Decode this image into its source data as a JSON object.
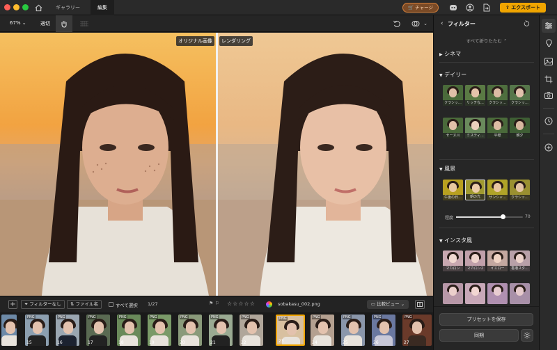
{
  "titlebar": {
    "tabs": [
      "ギャラリー",
      "編集"
    ],
    "charge_label": "チャージ",
    "export_label": "エクスポート"
  },
  "toolbar": {
    "zoom": "67%",
    "fit_label": "適切"
  },
  "canvas": {
    "original_label": "オリジナル画像",
    "rendered_label": "レンダリング"
  },
  "filmbar": {
    "filter_label": "フィルターなし",
    "file_label": "ファイル名",
    "select_all_label": "すべて選択",
    "count": "1/27",
    "filename": "sobakasu_002.png",
    "compare_label": "比較ビュー"
  },
  "film": {
    "items": [
      {
        "num": "",
        "png": ""
      },
      {
        "num": "15",
        "png": "PNG"
      },
      {
        "num": "16",
        "png": "PNG"
      },
      {
        "num": "17",
        "png": "PNG"
      },
      {
        "num": "18",
        "png": "PNG"
      },
      {
        "num": "19",
        "png": "PNG"
      },
      {
        "num": "20",
        "png": "PNG"
      },
      {
        "num": "21",
        "png": "PNG"
      },
      {
        "num": "22",
        "png": "PNG"
      },
      {
        "num": "23",
        "png": "PNG"
      },
      {
        "num": "24",
        "png": "PNG"
      },
      {
        "num": "25",
        "png": "PNG"
      },
      {
        "num": "26",
        "png": "PNG"
      },
      {
        "num": "27",
        "png": "PNG"
      }
    ]
  },
  "side": {
    "title": "フィルター",
    "collapse_all": "すべて折りたたむ",
    "sections": {
      "cinema": "シネマ",
      "daily": "デイリー",
      "scenery": "風景",
      "insta": "インスタ風"
    },
    "daily_tiles": [
      "クラシッ...",
      "リッチな...",
      "クラシッ...",
      "クラシッ...",
      "セーヌ川",
      "ミスティ...",
      "平穏",
      "朝夕"
    ],
    "scenery_tiles": [
      "午後の日...",
      "朝の光",
      "サンシャ...",
      "クラシッ..."
    ],
    "intensity_label": "程度",
    "intensity_value": "70",
    "insta_tiles": [
      "マカロン",
      "マカロン2",
      "イエロー",
      "香港スタ...",
      "",
      "",
      "",
      ""
    ],
    "save_preset": "プリセットを保存",
    "sync": "同期"
  },
  "colors": {
    "accent": "#f0a500",
    "charge": "#d9823b"
  }
}
